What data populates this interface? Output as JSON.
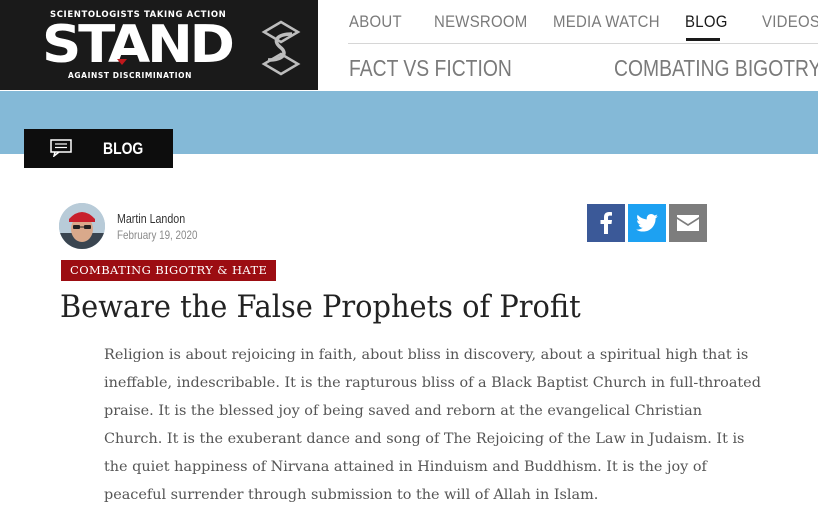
{
  "header": {
    "logo": {
      "top_line": "SCIENTOLOGISTS TAKING ACTION",
      "word": "STAND",
      "bottom_line": "AGAINST DISCRIMINATION",
      "mark_icon": "scientology-symbol-icon"
    },
    "nav_primary": [
      "ABOUT",
      "NEWSROOM",
      "MEDIA WATCH",
      "BLOG",
      "VIDEOS"
    ],
    "nav_active": "BLOG",
    "nav_secondary": [
      "FACT VS FICTION",
      "COMBATING BIGOTRY"
    ]
  },
  "banner": {
    "color": "#84b9d7",
    "section_label": "BLOG",
    "section_icon": "chat-bubble-icon"
  },
  "post": {
    "author": "Martin Landon",
    "date": "February 19, 2020",
    "tag": "COMBATING BIGOTRY & HATE",
    "tag_color": "#9c0d12",
    "title": "Beware the False Prophets of Profit",
    "body": "Religion is about rejoicing in faith, about bliss in discovery, about a spiritual high that is ineffable, indescribable. It is the rapturous bliss of a Black Baptist Church in full-throated praise. It is the blessed joy of being saved and reborn at the evangelical Christian Church. It is the exuberant dance and song of The Rejoicing of the Law in Judaism. It is the quiet happiness of Nirvana attained in Hinduism and Buddhism. It is the joy of peaceful surrender through submission to the will of Allah in Islam."
  },
  "share": {
    "icons": [
      "facebook-icon",
      "twitter-icon",
      "email-icon"
    ],
    "colors": {
      "facebook": "#3b5998",
      "twitter": "#1da1f2",
      "email": "#7d7d7d"
    }
  }
}
